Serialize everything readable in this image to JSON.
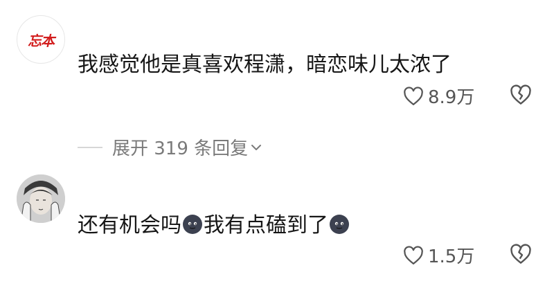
{
  "comments": [
    {
      "avatar_text": "忘本",
      "text": "我感觉他是真喜欢程潇，暗恋味儿太浓了",
      "likes": "8.9万",
      "replies_label": "展开 319 条回复"
    },
    {
      "text_part1": "还有机会吗",
      "text_part2": "我有点磕到了",
      "likes": "1.5万"
    }
  ],
  "colors": {
    "avatar_logo": "#d21c1c",
    "text": "#161616",
    "meta": "#7a7a7a"
  },
  "icons": [
    "heart-outline-icon",
    "broken-heart-icon",
    "chevron-down-icon",
    "smiling-dark-face-icon"
  ]
}
